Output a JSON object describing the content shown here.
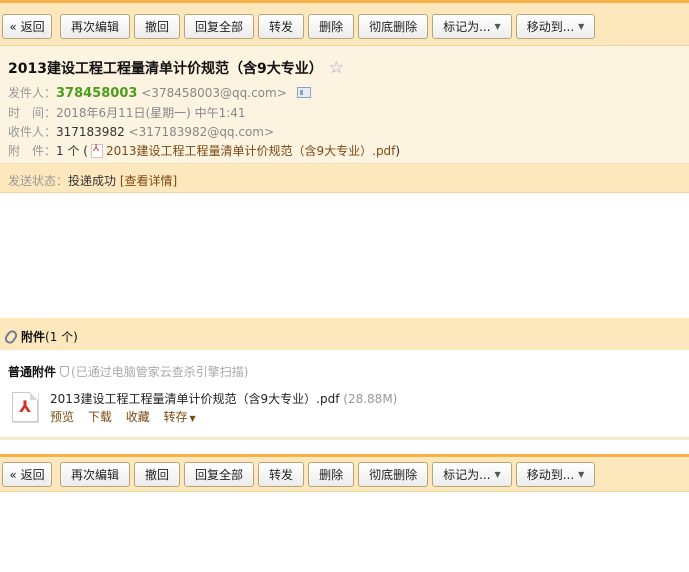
{
  "toolbar": {
    "back": "« 返回",
    "edit_again": "再次编辑",
    "recall": "撤回",
    "reply_all": "回复全部",
    "forward": "转发",
    "delete": "删除",
    "delete_forever": "彻底删除",
    "mark_as": "标记为...",
    "move_to": "移动到..."
  },
  "mail": {
    "subject": "2013建设工程工程量清单计价规范（含9大专业）",
    "from_label": "发件人：",
    "from_name": "378458003",
    "from_addr": "<378458003@qq.com>",
    "time_label": "时　间：",
    "time_value": "2018年6月11日(星期一) 中午1:41",
    "to_label": "收件人：",
    "to_name": "317183982",
    "to_addr": "<317183982@qq.com>",
    "att_label": "附　件：",
    "att_count": "1 个 (",
    "att_name": "2013建设工程工程量清单计价规范（含9大专业）.pdf",
    "att_close": ")"
  },
  "status": {
    "label": "发送状态：",
    "value": "投递成功",
    "detail": "[查看详情]"
  },
  "attachments": {
    "title": "附件",
    "count": "(1 个)",
    "type_label": "普通附件",
    "scan_text": "(已通过电脑管家云查杀引擎扫描)",
    "file_name": "2013建设工程工程量清单计价规范（含9大专业）.pdf",
    "file_size": "(28.88M)",
    "preview": "预览",
    "download": "下载",
    "favorite": "收藏",
    "save_to": "转存"
  }
}
